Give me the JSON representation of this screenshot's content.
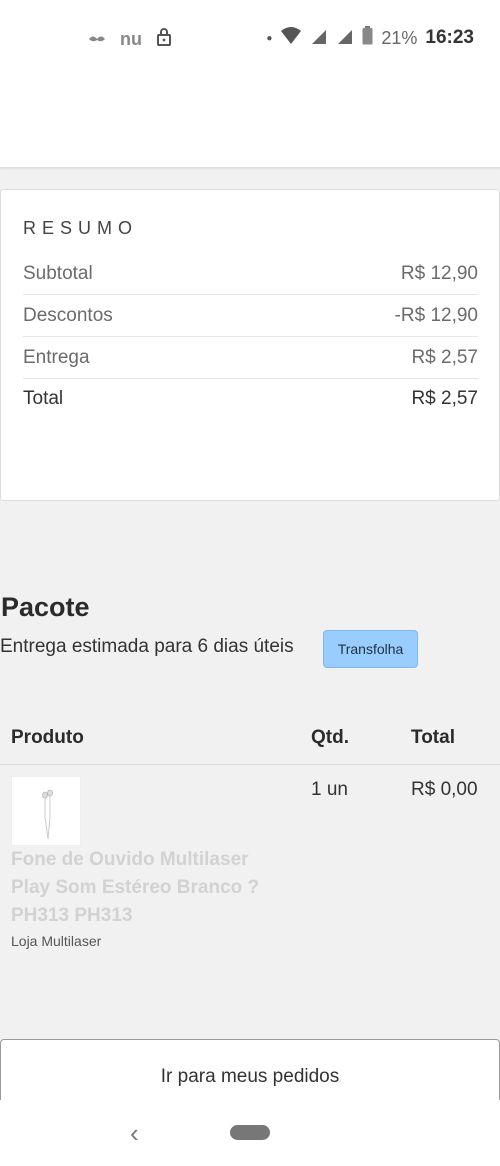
{
  "status_bar": {
    "left_icons": [
      "mustache-icon",
      "nu-logo-icon",
      "lock-icon"
    ],
    "nu_text": "nu",
    "battery_text": "21%",
    "time": "16:23"
  },
  "summary": {
    "title": "RESUMO",
    "rows": [
      {
        "label": "Subtotal",
        "value": "R$ 12,90"
      },
      {
        "label": "Descontos",
        "value": "-R$ 12,90"
      },
      {
        "label": "Entrega",
        "value": "R$ 2,57"
      },
      {
        "label": "Total",
        "value": "R$ 2,57"
      }
    ]
  },
  "package": {
    "title": "Pacote",
    "estimate": "Entrega estimada para 6 dias úteis",
    "carrier": "Transfolha"
  },
  "table": {
    "headers": {
      "product": "Produto",
      "qty": "Qtd.",
      "total": "Total"
    },
    "items": [
      {
        "name": "Fone de Ouvido Multilaser Play Som Estéreo Branco ? PH313 PH313",
        "store": "Loja Multilaser",
        "qty": "1 un",
        "total": "R$ 0,00"
      }
    ]
  },
  "actions": {
    "orders_button": "Ir para meus pedidos"
  },
  "nav": {
    "back_glyph": "‹"
  }
}
